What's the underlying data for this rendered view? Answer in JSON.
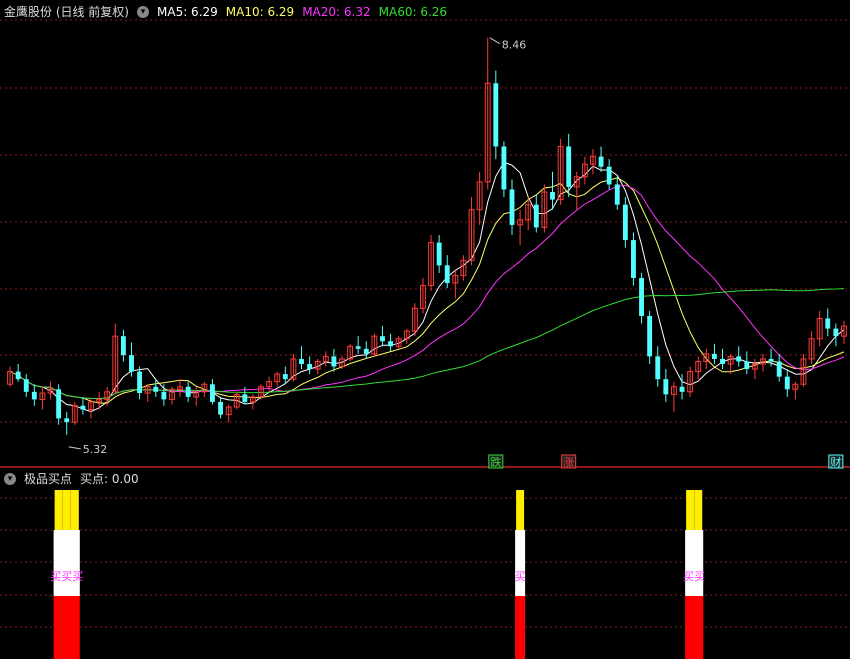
{
  "header": {
    "title": "金鹰股份 (日线 前复权)",
    "ma5": "MA5: 6.29",
    "ma10": "MA10: 6.29",
    "ma20": "MA20: 6.32",
    "ma60": "MA60: 6.26"
  },
  "subpanel": {
    "title": "极品买点",
    "value": "买点: 0.00"
  },
  "colors": {
    "up": "#ff3b3b",
    "down": "#54ffff",
    "ma5": "#ffffff",
    "ma10": "#ffff66",
    "ma20": "#ff33ff",
    "ma60": "#33dd33",
    "grid": "#8b1a1a",
    "yellow": "#ffee00",
    "red": "#ff0000",
    "white": "#ffffff",
    "magenta": "#ff33ff"
  },
  "chart_data": {
    "type": "candlestick",
    "annotations": {
      "high": "8.46",
      "low": "5.32"
    },
    "markers": [
      {
        "label": "跌",
        "color": "#33dd33",
        "bar": 60
      },
      {
        "label": "涨",
        "color": "#ff3b3b",
        "bar": 69
      },
      {
        "label": "财",
        "color": "#54ffff",
        "bar": 102
      }
    ],
    "buy_signals": [
      {
        "bars": [
          6,
          7,
          8
        ],
        "label": "买买买"
      },
      {
        "bars": [
          63
        ],
        "label": "买"
      },
      {
        "bars": [
          84,
          85
        ],
        "label": "买买"
      }
    ],
    "ohlc": [
      [
        5.72,
        5.86,
        5.7,
        5.82
      ],
      [
        5.82,
        5.88,
        5.74,
        5.76
      ],
      [
        5.76,
        5.8,
        5.62,
        5.66
      ],
      [
        5.66,
        5.72,
        5.55,
        5.6
      ],
      [
        5.6,
        5.7,
        5.52,
        5.65
      ],
      [
        5.65,
        5.74,
        5.6,
        5.68
      ],
      [
        5.68,
        5.72,
        5.4,
        5.45
      ],
      [
        5.45,
        5.5,
        5.32,
        5.42
      ],
      [
        5.42,
        5.58,
        5.4,
        5.55
      ],
      [
        5.55,
        5.62,
        5.48,
        5.52
      ],
      [
        5.52,
        5.6,
        5.45,
        5.58
      ],
      [
        5.58,
        5.66,
        5.52,
        5.6
      ],
      [
        5.6,
        5.7,
        5.55,
        5.66
      ],
      [
        5.66,
        6.2,
        5.64,
        6.1
      ],
      [
        6.1,
        6.15,
        5.9,
        5.95
      ],
      [
        5.95,
        6.05,
        5.78,
        5.82
      ],
      [
        5.82,
        5.86,
        5.6,
        5.65
      ],
      [
        5.65,
        5.72,
        5.58,
        5.7
      ],
      [
        5.7,
        5.76,
        5.62,
        5.66
      ],
      [
        5.66,
        5.72,
        5.55,
        5.6
      ],
      [
        5.6,
        5.7,
        5.56,
        5.68
      ],
      [
        5.68,
        5.76,
        5.62,
        5.7
      ],
      [
        5.7,
        5.74,
        5.58,
        5.62
      ],
      [
        5.62,
        5.7,
        5.55,
        5.66
      ],
      [
        5.66,
        5.74,
        5.62,
        5.72
      ],
      [
        5.72,
        5.76,
        5.56,
        5.58
      ],
      [
        5.58,
        5.62,
        5.45,
        5.48
      ],
      [
        5.48,
        5.56,
        5.42,
        5.54
      ],
      [
        5.54,
        5.66,
        5.52,
        5.64
      ],
      [
        5.64,
        5.7,
        5.56,
        5.58
      ],
      [
        5.58,
        5.64,
        5.52,
        5.62
      ],
      [
        5.62,
        5.72,
        5.6,
        5.7
      ],
      [
        5.7,
        5.78,
        5.66,
        5.74
      ],
      [
        5.74,
        5.82,
        5.7,
        5.8
      ],
      [
        5.8,
        5.86,
        5.72,
        5.76
      ],
      [
        5.76,
        5.96,
        5.74,
        5.92
      ],
      [
        5.92,
        6.02,
        5.84,
        5.88
      ],
      [
        5.88,
        5.94,
        5.8,
        5.84
      ],
      [
        5.84,
        5.92,
        5.8,
        5.9
      ],
      [
        5.9,
        5.98,
        5.86,
        5.94
      ],
      [
        5.94,
        6.0,
        5.82,
        5.86
      ],
      [
        5.86,
        5.94,
        5.84,
        5.92
      ],
      [
        5.92,
        6.04,
        5.9,
        6.02
      ],
      [
        6.02,
        6.1,
        5.96,
        6.0
      ],
      [
        6.0,
        6.06,
        5.92,
        5.96
      ],
      [
        5.96,
        6.12,
        5.94,
        6.1
      ],
      [
        6.1,
        6.18,
        6.02,
        6.06
      ],
      [
        6.06,
        6.12,
        5.98,
        6.02
      ],
      [
        6.02,
        6.1,
        6.0,
        6.08
      ],
      [
        6.08,
        6.16,
        6.04,
        6.14
      ],
      [
        6.14,
        6.36,
        6.1,
        6.32
      ],
      [
        6.32,
        6.56,
        6.28,
        6.5
      ],
      [
        6.5,
        6.9,
        6.46,
        6.84
      ],
      [
        6.84,
        6.9,
        6.6,
        6.66
      ],
      [
        6.66,
        6.74,
        6.48,
        6.52
      ],
      [
        6.52,
        6.62,
        6.4,
        6.58
      ],
      [
        6.58,
        6.74,
        6.54,
        6.7
      ],
      [
        6.7,
        7.2,
        6.66,
        7.1
      ],
      [
        7.1,
        7.4,
        6.98,
        7.32
      ],
      [
        7.32,
        8.46,
        7.26,
        8.1
      ],
      [
        8.1,
        8.2,
        7.5,
        7.6
      ],
      [
        7.6,
        7.64,
        7.2,
        7.26
      ],
      [
        7.26,
        7.34,
        6.9,
        6.98
      ],
      [
        6.98,
        7.1,
        6.82,
        7.02
      ],
      [
        7.02,
        7.2,
        6.94,
        7.14
      ],
      [
        7.14,
        7.22,
        6.92,
        6.96
      ],
      [
        6.96,
        7.3,
        6.92,
        7.24
      ],
      [
        7.24,
        7.4,
        7.1,
        7.18
      ],
      [
        7.18,
        7.66,
        7.14,
        7.6
      ],
      [
        7.6,
        7.7,
        7.2,
        7.28
      ],
      [
        7.28,
        7.4,
        7.1,
        7.36
      ],
      [
        7.36,
        7.52,
        7.3,
        7.46
      ],
      [
        7.46,
        7.58,
        7.38,
        7.52
      ],
      [
        7.52,
        7.6,
        7.4,
        7.44
      ],
      [
        7.44,
        7.5,
        7.26,
        7.3
      ],
      [
        7.3,
        7.36,
        7.1,
        7.14
      ],
      [
        7.14,
        7.2,
        6.8,
        6.86
      ],
      [
        6.86,
        6.92,
        6.5,
        6.56
      ],
      [
        6.56,
        6.6,
        6.2,
        6.26
      ],
      [
        6.26,
        6.3,
        5.88,
        5.94
      ],
      [
        5.94,
        6.02,
        5.7,
        5.76
      ],
      [
        5.76,
        5.84,
        5.58,
        5.64
      ],
      [
        5.64,
        5.74,
        5.5,
        5.7
      ],
      [
        5.7,
        5.8,
        5.6,
        5.66
      ],
      [
        5.66,
        5.86,
        5.62,
        5.82
      ],
      [
        5.82,
        5.94,
        5.76,
        5.9
      ],
      [
        5.9,
        6.0,
        5.84,
        5.96
      ],
      [
        5.96,
        6.04,
        5.88,
        5.92
      ],
      [
        5.92,
        6.0,
        5.84,
        5.88
      ],
      [
        5.88,
        5.96,
        5.8,
        5.94
      ],
      [
        5.94,
        6.02,
        5.86,
        5.9
      ],
      [
        5.9,
        5.98,
        5.8,
        5.84
      ],
      [
        5.84,
        5.92,
        5.76,
        5.88
      ],
      [
        5.88,
        5.96,
        5.82,
        5.92
      ],
      [
        5.92,
        6.0,
        5.86,
        5.9
      ],
      [
        5.9,
        5.96,
        5.74,
        5.78
      ],
      [
        5.78,
        5.84,
        5.62,
        5.68
      ],
      [
        5.68,
        5.74,
        5.6,
        5.72
      ],
      [
        5.72,
        5.96,
        5.7,
        5.92
      ],
      [
        5.92,
        6.14,
        5.88,
        6.08
      ],
      [
        6.08,
        6.3,
        6.02,
        6.24
      ],
      [
        6.24,
        6.32,
        6.1,
        6.16
      ],
      [
        6.16,
        6.2,
        6.02,
        6.1
      ],
      [
        6.1,
        6.22,
        6.04,
        6.18
      ]
    ]
  }
}
